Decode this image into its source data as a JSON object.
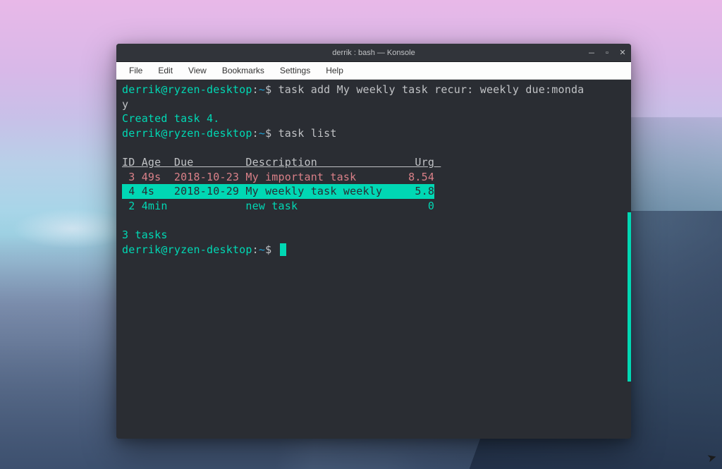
{
  "window": {
    "title": "derrik : bash — Konsole"
  },
  "menubar": {
    "items": [
      "File",
      "Edit",
      "View",
      "Bookmarks",
      "Settings",
      "Help"
    ]
  },
  "prompt": {
    "user": "derrik@ryzen-desktop",
    "colon": ":",
    "path": "~",
    "dollar": "$"
  },
  "session": {
    "cmd1_part1": "task add My weekly task recur: weekly due:monda",
    "cmd1_part2": "y",
    "out1": "Created task 4.",
    "cmd2": "task list",
    "header": "ID Age  Due        Description               Urg ",
    "row1": " 3 49s  2018-10-23 My important task        8.54",
    "row2": " 4 4s   2018-10-29 My weekly task weekly     5.8",
    "row3": " 2 4min            new task                    0",
    "summary": "3 tasks"
  },
  "task_data": {
    "columns": [
      "ID",
      "Age",
      "Due",
      "Description",
      "Urg"
    ],
    "rows": [
      {
        "id": 3,
        "age": "49s",
        "due": "2018-10-23",
        "description": "My important task",
        "urg": 8.54
      },
      {
        "id": 4,
        "age": "4s",
        "due": "2018-10-29",
        "description": "My weekly task weekly",
        "urg": 5.8
      },
      {
        "id": 2,
        "age": "4min",
        "due": "",
        "description": "new task",
        "urg": 0
      }
    ],
    "total": 3
  }
}
